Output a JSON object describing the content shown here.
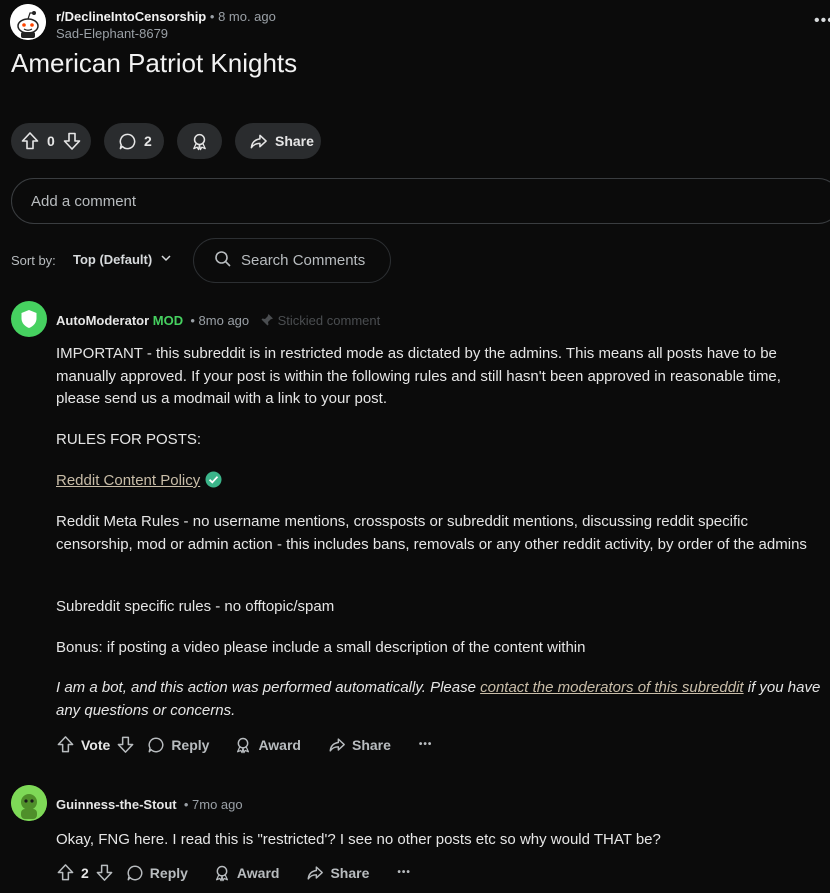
{
  "post": {
    "subreddit": "r/DeclineIntoCensorship",
    "separator": "•",
    "age": "8 mo. ago",
    "author": "Sad-Elephant-8679",
    "more": "•••",
    "title": "American Patriot Knights",
    "score": "0",
    "comments": "2",
    "share_label": "Share"
  },
  "composer": {
    "placeholder": "Add a comment"
  },
  "sort": {
    "label": "Sort by:",
    "value": "Top (Default)",
    "search_placeholder": "Search Comments"
  },
  "comments": [
    {
      "author": "AutoModerator",
      "flair": "MOD",
      "age": "8mo ago",
      "stickied": "Stickied comment",
      "avatar_color": "#46d160",
      "paragraphs": {
        "p1": "IMPORTANT - this subreddit is in restricted mode as dictated by the admins. This means all posts have to be manually approved. If your post is within the following rules and still hasn't been approved in reasonable time, please send us a modmail with a link to your post.",
        "p2": "RULES FOR POSTS:",
        "p3_link": "Reddit Content Policy",
        "p4": "Reddit Meta Rules - no username mentions, crossposts or subreddit mentions, discussing reddit specific censorship, mod or admin action - this includes bans, removals or any other reddit activity, by order of the admins",
        "p5": "Subreddit specific rules - no offtopic/spam",
        "p6": "Bonus: if posting a video please include a small description of the content within",
        "bot_prefix": "I am a bot, and this action was performed automatically. Please ",
        "bot_link": "contact the moderators of this subreddit",
        "bot_suffix": " if you have any questions or concerns."
      },
      "score": "Vote",
      "reply": "Reply",
      "award": "Award",
      "share": "Share",
      "more": "•••"
    },
    {
      "author": "Guinness-the-Stout",
      "age": "7mo ago",
      "avatar_color": "#7ed957",
      "body": "Okay, FNG here. I read this is \"restricted'? I see no other posts etc so why would THAT be?",
      "score": "2",
      "reply": "Reply",
      "award": "Award",
      "share": "Share",
      "more": "•••"
    }
  ],
  "colors": {
    "background": "#0b0b0b",
    "pill": "#2a2c2e",
    "mod_green": "#46d160",
    "link": "#c9bda8"
  }
}
